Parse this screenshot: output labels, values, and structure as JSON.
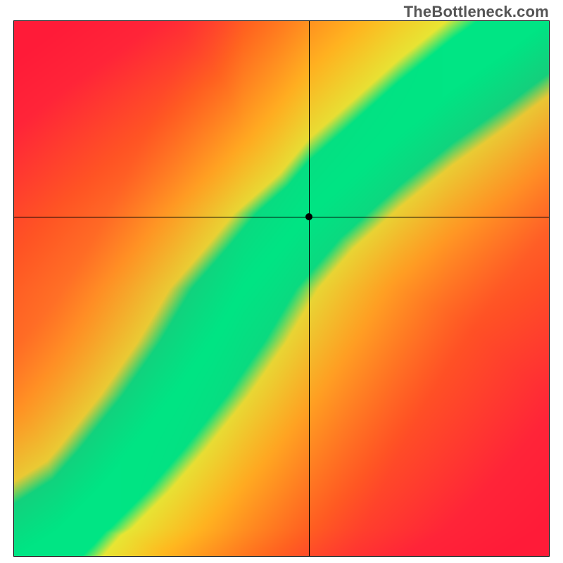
{
  "watermark": "TheBottleneck.com",
  "chart_data": {
    "type": "heatmap",
    "title": "",
    "xlabel": "",
    "ylabel": "",
    "xlim": [
      0,
      1
    ],
    "ylim": [
      0,
      1
    ],
    "crosshair": {
      "x": 0.551,
      "y": 0.634
    },
    "marker": {
      "x": 0.551,
      "y": 0.634
    },
    "optimal_curve": {
      "description": "approximate centerline of the green band (y = optimal match for x)",
      "points": [
        {
          "x": 0.0,
          "y": 0.0
        },
        {
          "x": 0.08,
          "y": 0.05
        },
        {
          "x": 0.15,
          "y": 0.12
        },
        {
          "x": 0.22,
          "y": 0.2
        },
        {
          "x": 0.3,
          "y": 0.3
        },
        {
          "x": 0.37,
          "y": 0.4
        },
        {
          "x": 0.43,
          "y": 0.5
        },
        {
          "x": 0.5,
          "y": 0.58
        },
        {
          "x": 0.55,
          "y": 0.64
        },
        {
          "x": 0.63,
          "y": 0.71
        },
        {
          "x": 0.72,
          "y": 0.79
        },
        {
          "x": 0.82,
          "y": 0.87
        },
        {
          "x": 0.92,
          "y": 0.94
        },
        {
          "x": 1.0,
          "y": 1.0
        }
      ]
    },
    "band_half_width": 0.055,
    "color_scale": {
      "description": "red → orange → yellow → green as distance from optimal curve decreases",
      "stops": [
        {
          "d": 0.0,
          "color": "#00e584"
        },
        {
          "d": 0.05,
          "color": "#00e584"
        },
        {
          "d": 0.1,
          "color": "#e8e634"
        },
        {
          "d": 0.25,
          "color": "#ffbf1f"
        },
        {
          "d": 0.5,
          "color": "#ff7a1a"
        },
        {
          "d": 0.8,
          "color": "#ff2a3a"
        },
        {
          "d": 1.0,
          "color": "#ff1a3a"
        }
      ]
    },
    "corner_tint": {
      "top_right_yellow_strength": 0.55,
      "bottom_left_red_strength": 0.0
    }
  }
}
